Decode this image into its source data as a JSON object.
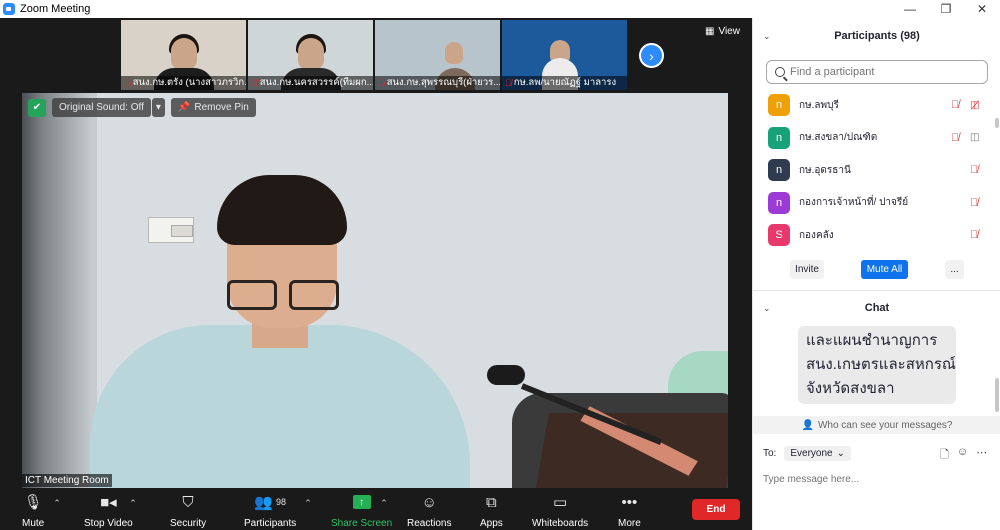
{
  "window": {
    "title": "Zoom Meeting",
    "controls": [
      "—",
      "❐",
      "✕"
    ]
  },
  "thumbnails": [
    {
      "label": "สนง.กษ.ตรัง (นางสาวภรวิก...",
      "muted": true,
      "bg": "#d9d2c8"
    },
    {
      "label": "สนง.กษ.นครสวรรค์(ทีมผก...",
      "muted": true,
      "bg": "#cfd6d8"
    },
    {
      "label": "สนง.กษ.สุพรรณบุรี(ฝ่ายวร...",
      "muted": true,
      "bg": "#b8c4cc"
    },
    {
      "label": "กษ.ลพ/นายณัฏฐ์ มาลารง",
      "muted": true,
      "bg": "#1c5a9c"
    }
  ],
  "video": {
    "view_label": "View",
    "original_sound": "Original Sound: Off",
    "remove_pin": "Remove Pin",
    "room_name": "ICT Meeting Room"
  },
  "toolbar": {
    "mute": "Mute",
    "stop_video": "Stop Video",
    "security": "Security",
    "participants": "Participants",
    "participants_count": "98",
    "share_screen": "Share Screen",
    "reactions": "Reactions",
    "apps": "Apps",
    "whiteboards": "Whiteboards",
    "more": "More",
    "end": "End"
  },
  "participants_panel": {
    "title": "Participants (98)",
    "search_placeholder": "Find a participant",
    "list": [
      {
        "initial": "n",
        "name": "กษ.ลพบุรี",
        "color": "#f0a007",
        "video": "off"
      },
      {
        "initial": "n",
        "name": "กษ.สงขลา/ปณฑิต",
        "color": "#18a27a",
        "video": "on"
      },
      {
        "initial": "n",
        "name": "กษ.อุดรธานี",
        "color": "#2f3b4e",
        "video": "none"
      },
      {
        "initial": "n",
        "name": "กองการเจ้าหน้าที่/ ปาจรีย์",
        "color": "#9b3ad4",
        "video": "none"
      },
      {
        "initial": "S",
        "name": "กองคลัง",
        "color": "#e8386c",
        "video": "none"
      }
    ],
    "invite": "Invite",
    "mute_all": "Mute All",
    "more": "..."
  },
  "chat_panel": {
    "title": "Chat",
    "message_lines": [
      "และแผนชำนาญการ",
      "สนง.เกษตรและสหกรณ์",
      "จังหวัดสงขลา"
    ],
    "who_can_see": "Who can see your messages?",
    "to_label": "To:",
    "to_value": "Everyone",
    "input_placeholder": "Type message here..."
  },
  "colors": {
    "accent": "#0e72ed",
    "end_red": "#e02828",
    "share_green": "#26b055",
    "muted_red": "#d93636"
  }
}
